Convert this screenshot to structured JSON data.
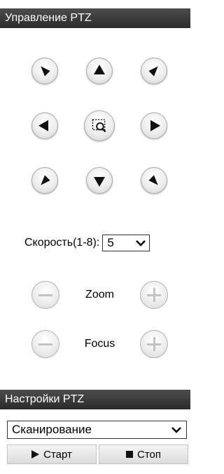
{
  "ptz_control": {
    "title": "Управление PTZ",
    "buttons": [
      {
        "name": "pan-up-left-button",
        "icon": "arrow-up-left-icon"
      },
      {
        "name": "pan-up-button",
        "icon": "arrow-up-icon"
      },
      {
        "name": "pan-up-right-button",
        "icon": "arrow-up-right-icon"
      },
      {
        "name": "pan-left-button",
        "icon": "arrow-left-icon"
      },
      {
        "name": "ptz-center-button",
        "icon": "zoom-area-icon"
      },
      {
        "name": "pan-right-button",
        "icon": "arrow-right-icon"
      },
      {
        "name": "pan-down-left-button",
        "icon": "arrow-down-left-icon"
      },
      {
        "name": "pan-down-button",
        "icon": "arrow-down-icon"
      },
      {
        "name": "pan-down-right-button",
        "icon": "arrow-down-right-icon"
      }
    ]
  },
  "speed": {
    "label": "Скорость(1-8):",
    "value": "5",
    "icon": "chevron-down-icon"
  },
  "zoom": {
    "label": "Zoom",
    "minus_icon": "minus-icon",
    "plus_icon": "plus-icon"
  },
  "focus": {
    "label": "Focus",
    "minus_icon": "minus-icon",
    "plus_icon": "plus-icon"
  },
  "settings": {
    "title": "Настройки PTZ",
    "mode_value": "Сканирование",
    "start_label": "Старт",
    "stop_label": "Стоп",
    "start_icon": "play-icon",
    "stop_icon": "stop-icon"
  },
  "colors": {
    "header_bg": "#3a3a3a",
    "header_text": "#ffffff",
    "button_face": "#ededed",
    "button_border": "#a9a9a9"
  }
}
